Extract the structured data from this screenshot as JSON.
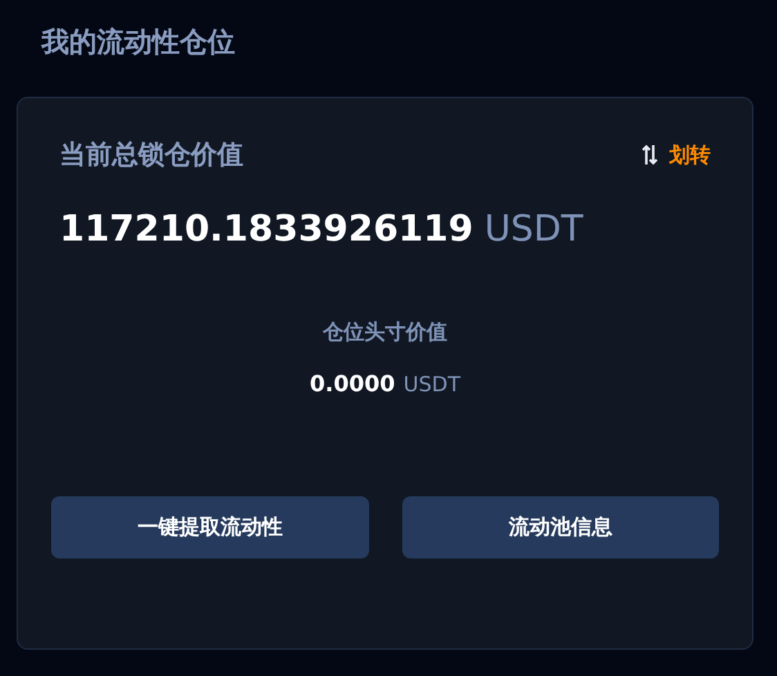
{
  "page_title": "我的流动性仓位",
  "card": {
    "label": "当前总锁仓价值",
    "transfer_link": "划转",
    "total_value": "117210.1833926119",
    "total_unit": "USDT",
    "position_label": "仓位头寸价值",
    "position_value": "0.0000",
    "position_unit": "USDT",
    "buttons": [
      {
        "label": "一键提取流动性"
      },
      {
        "label": "流动池信息"
      }
    ]
  }
}
